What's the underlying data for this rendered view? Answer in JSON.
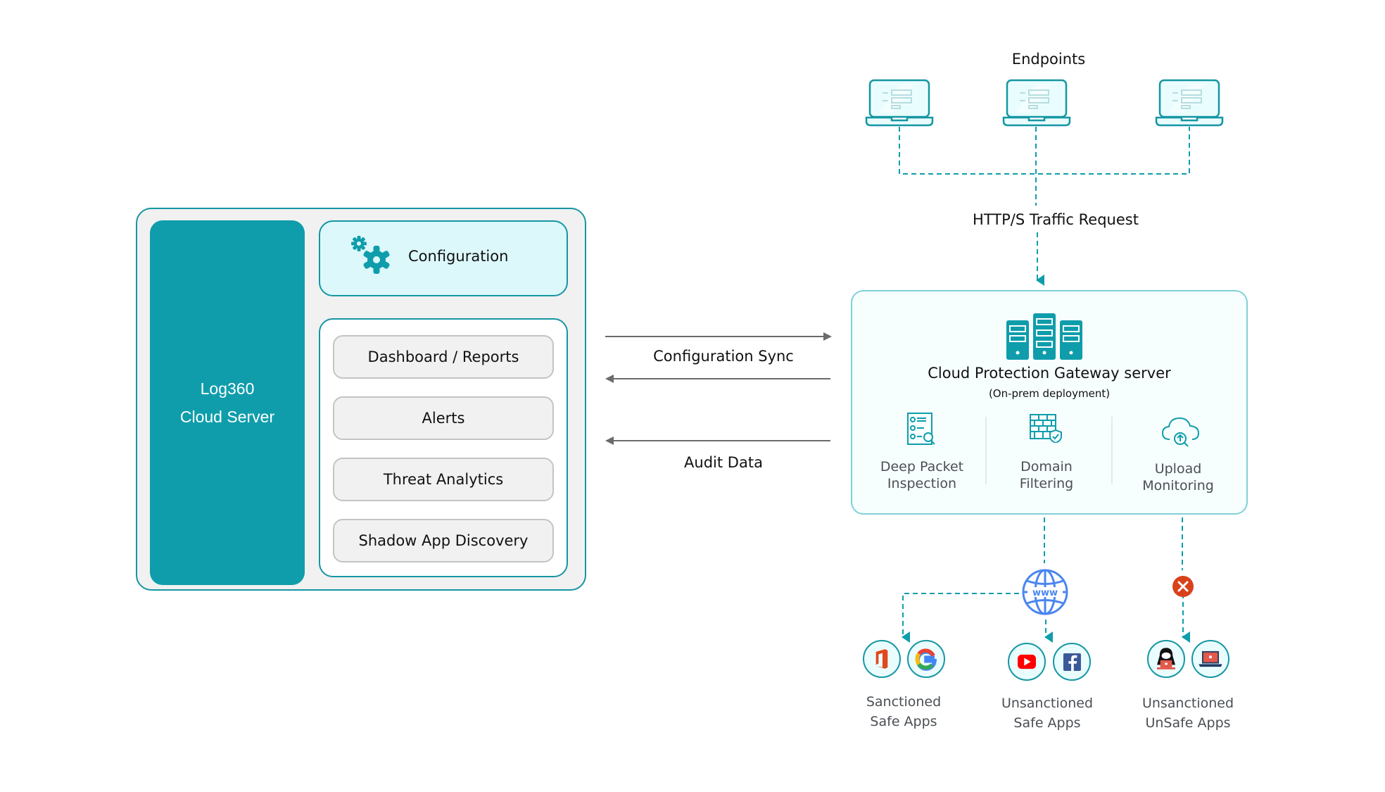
{
  "log360": {
    "title_line1": "Log360",
    "title_line2": "Cloud Server",
    "configuration": {
      "label": "Configuration",
      "icon": "gear-icon"
    },
    "modules": [
      {
        "label": "Dashboard / Reports"
      },
      {
        "label": "Alerts"
      },
      {
        "label": "Threat Analytics"
      },
      {
        "label": "Shadow App Discovery"
      }
    ]
  },
  "flows": {
    "configuration_sync": "Configuration Sync",
    "audit_data": "Audit Data",
    "http_request": "HTTP/S Traffic Request"
  },
  "endpoints": {
    "title": "Endpoints",
    "count": 3,
    "icon": "laptop-icon"
  },
  "gateway": {
    "title": "Cloud Protection Gateway server",
    "subtitle": "(On-prem deployment)",
    "icon": "server-rack-icon",
    "features": [
      {
        "line1": "Deep Packet",
        "line2": "Inspection",
        "icon": "checklist-search-icon"
      },
      {
        "line1": "Domain",
        "line2": "Filtering",
        "icon": "firewall-shield-icon"
      },
      {
        "line1": "Upload",
        "line2": "Monitoring",
        "icon": "cloud-upload-search-icon"
      }
    ]
  },
  "internet": {
    "icon": "www-globe-icon",
    "label": "www"
  },
  "blocked": {
    "icon": "blocked-x-icon"
  },
  "app_groups": [
    {
      "line1": "Sanctioned",
      "line2": "Safe Apps",
      "apps": [
        "office-icon",
        "google-icon"
      ]
    },
    {
      "line1": "Unsanctioned",
      "line2": "Safe Apps",
      "apps": [
        "youtube-icon",
        "facebook-icon"
      ]
    },
    {
      "line1": "Unsanctioned",
      "line2": "UnSafe Apps",
      "apps": [
        "hacker-icon",
        "malware-laptop-icon"
      ]
    }
  ],
  "colors": {
    "teal": "#0f9dab",
    "teal_border": "#1596a3",
    "light_teal": "#dcf8fb",
    "gateway_border": "#7fd1d8",
    "arrow_gray": "#6b6b6b",
    "globe_blue": "#4a86f0",
    "block_red": "#d9411b"
  }
}
